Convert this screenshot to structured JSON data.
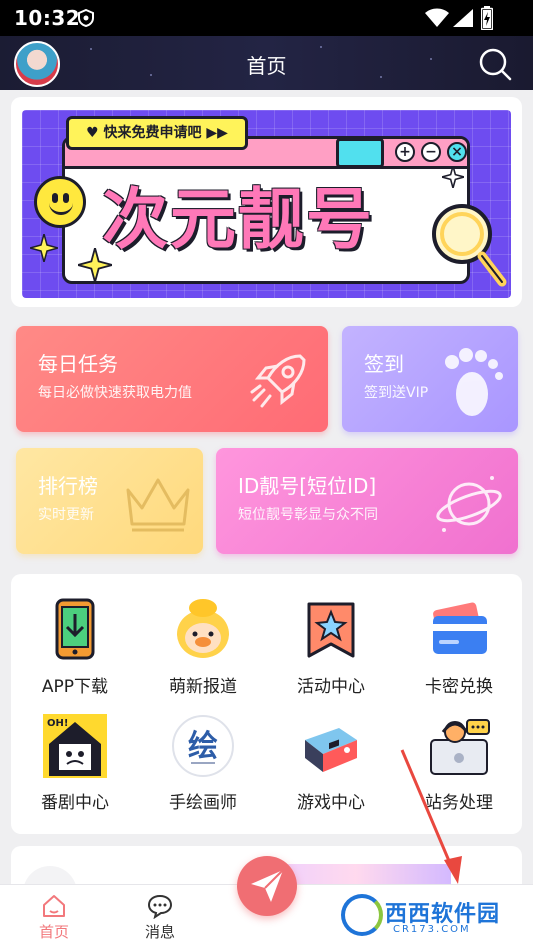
{
  "status_bar": {
    "time": "10:32"
  },
  "header": {
    "title": "首页"
  },
  "banner": {
    "pill_text": "♥ 快来免费申请吧 ▶▶",
    "title": "次元靓号",
    "win_buttons": [
      "+",
      "−",
      "×"
    ]
  },
  "quick_cards": [
    {
      "title": "每日任务",
      "subtitle": "每日必做快速获取电力值",
      "icon": "rocket-icon",
      "color": "#ff7a7e"
    },
    {
      "title": "签到",
      "subtitle": "签到送VIP",
      "icon": "footprint-icon",
      "color": "#b3a2ff"
    },
    {
      "title": "排行榜",
      "subtitle": "实时更新",
      "icon": "crown-icon",
      "color": "#ffdf8c"
    },
    {
      "title": "ID靓号[短位ID]",
      "subtitle": "短位靓号彰显与众不同",
      "icon": "planet-icon",
      "color": "#f680d6"
    }
  ],
  "grid": [
    {
      "label": "APP下载",
      "icon": "phone-download-icon"
    },
    {
      "label": "萌新报道",
      "icon": "duck-mascot-icon"
    },
    {
      "label": "活动中心",
      "icon": "star-badge-icon"
    },
    {
      "label": "卡密兑换",
      "icon": "card-icon"
    },
    {
      "label": "番剧中心",
      "icon": "anime-house-icon"
    },
    {
      "label": "手绘画师",
      "icon": "paint-logo-icon",
      "logo_text": "绘"
    },
    {
      "label": "游戏中心",
      "icon": "game-console-icon"
    },
    {
      "label": "站务处理",
      "icon": "support-agent-icon"
    }
  ],
  "tabbar": {
    "items": [
      {
        "label": "首页",
        "icon": "home-icon",
        "active": true
      },
      {
        "label": "消息",
        "icon": "message-icon",
        "active": false
      }
    ],
    "fab_icon": "paper-plane-icon"
  },
  "watermark": {
    "text": "西西软件园",
    "sub": "CR173.COM"
  },
  "colors": {
    "accent": "#f06e73",
    "header_bg": "#1f2038",
    "banner_bg": "#6e4cf0"
  }
}
